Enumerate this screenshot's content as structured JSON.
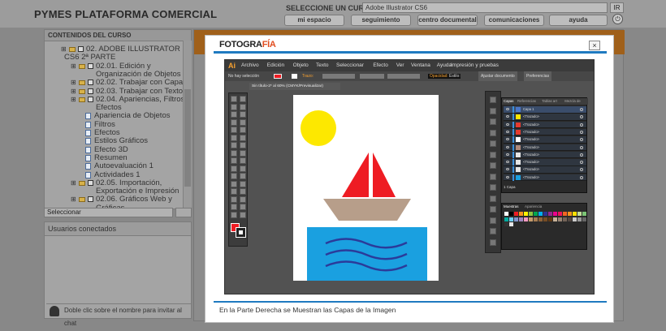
{
  "header": {
    "title": "PYMES PLATAFORMA COMERCIAL",
    "course_label": "SELECCIONE UN CURSO:",
    "course_value": "Adobe Illustrator CS6",
    "go_label": "IR",
    "help_icon": "?",
    "power_icon": "⏻",
    "nav": [
      "mi espacio",
      "seguimiento",
      "centro documental",
      "comunicaciones",
      "ayuda"
    ]
  },
  "sidebar": {
    "caption": "CONTENIDOS DEL CURSO",
    "items": [
      {
        "label": "02. ADOBE ILLUSTRATOR",
        "level": 0,
        "type": "folder"
      },
      {
        "label": "CS6 2ª PARTE",
        "level": 0,
        "type": "cont"
      },
      {
        "label": "02.01. Edición y",
        "level": 1,
        "type": "folder"
      },
      {
        "label": "Organización de Objetos",
        "level": 1,
        "type": "cont"
      },
      {
        "label": "02.02. Trabajar con Capas",
        "level": 1,
        "type": "folder"
      },
      {
        "label": "02.03. Trabajar con Texto",
        "level": 1,
        "type": "folder"
      },
      {
        "label": "02.04. Apariencias, Filtros y",
        "level": 1,
        "type": "folder"
      },
      {
        "label": "Efectos",
        "level": 1,
        "type": "cont0"
      },
      {
        "label": "Apariencia de Objetos",
        "level": 2,
        "type": "doc"
      },
      {
        "label": "Filtros",
        "level": 2,
        "type": "doc"
      },
      {
        "label": "Efectos",
        "level": 2,
        "type": "doc"
      },
      {
        "label": "Estilos Gráficos",
        "level": 2,
        "type": "doc"
      },
      {
        "label": "Efecto 3D",
        "level": 2,
        "type": "doc"
      },
      {
        "label": "Resumen",
        "level": 2,
        "type": "doc"
      },
      {
        "label": "Autoevaluación 1",
        "level": 2,
        "type": "doc"
      },
      {
        "label": "Actividades 1",
        "level": 2,
        "type": "doc"
      },
      {
        "label": "02.05. Importación,",
        "level": 1,
        "type": "folder"
      },
      {
        "label": "Exportación e Impresión",
        "level": 1,
        "type": "cont0"
      },
      {
        "label": "02.06. Gráficos Web y",
        "level": 1,
        "type": "folder"
      },
      {
        "label": "Gráficas",
        "level": 1,
        "type": "cont0"
      }
    ],
    "select_label": "Seleccionar"
  },
  "users": {
    "caption": "Usuarios conectados",
    "hint": "Doble clic sobre el nombre para invitar al chat"
  },
  "modal": {
    "logo_a": "FOTOGRA",
    "logo_b": "FÍA",
    "close": "×",
    "caption": "En la Parte Derecha se Muestran las Capas de la Imagen"
  },
  "illustrator": {
    "app": "Ai",
    "menu": [
      "Archivo",
      "Edición",
      "Objeto",
      "Texto",
      "Seleccionar",
      "Efecto",
      "Ver",
      "Ventana",
      "Ayuda"
    ],
    "workspace": "Impresión y pruebas",
    "control": {
      "nosel": "No hay selección",
      "trazo": "Trazo:",
      "opacidad": "Opacidad:",
      "estilo": "Estilo:",
      "ajustar": "Ajustar documento",
      "pref": "Preferencias"
    },
    "doc_tab": "Sin título-2* al 60% (CMYK/Previsualizar)",
    "panel_tabs": [
      "Capas",
      "Referencias",
      "Tablas art",
      "Mezcla de"
    ],
    "layers": [
      {
        "name": "Capa 1",
        "thumb": "#4a76c9"
      },
      {
        "name": "<Trazado>",
        "thumb": "#ffe700"
      },
      {
        "name": "<Trazado>",
        "thumb": "#e53a2e"
      },
      {
        "name": "<Trazado>",
        "thumb": "#e53a2e"
      },
      {
        "name": "<Trazado>",
        "thumb": "#ffffff"
      },
      {
        "name": "<Trazado>",
        "thumb": "#b08a7a"
      },
      {
        "name": "<Trazado>",
        "thumb": "#e6e6e6"
      },
      {
        "name": "<Trazado>",
        "thumb": "#e6e6e6"
      },
      {
        "name": "<Trazado>",
        "thumb": "#e6e6e6"
      },
      {
        "name": "<Trazado>",
        "thumb": "#1aa0e0"
      }
    ],
    "layers_count": "1 Capa",
    "swatch_tabs": [
      "Muestras",
      "Apariencia"
    ],
    "colors": {
      "sun": "#fde800",
      "sail": "#ee1c23",
      "hull": "#b79e8a",
      "sea": "#1aa0e0",
      "wave": "#2b3b9a"
    }
  }
}
